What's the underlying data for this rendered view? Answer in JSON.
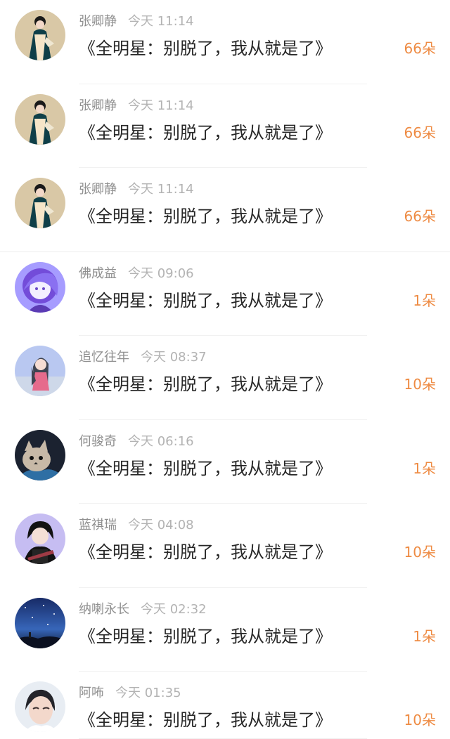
{
  "rows": [
    {
      "name": "张卿静",
      "time": "今天 11:14",
      "message": "《全明星：别脱了，我从就是了》",
      "count": "66朵",
      "avatar_icon": "hanfu-avatar-icon",
      "avatar_palette": [
        "#d9c8a6",
        "#0f3f48",
        "#f5e5c8"
      ]
    },
    {
      "name": "张卿静",
      "time": "今天 11:14",
      "message": "《全明星：别脱了，我从就是了》",
      "count": "66朵",
      "avatar_icon": "hanfu-avatar-icon",
      "avatar_palette": [
        "#d9c8a6",
        "#0f3f48",
        "#f5e5c8"
      ]
    },
    {
      "name": "张卿静",
      "time": "今天 11:14",
      "message": "《全明星：别脱了，我从就是了》",
      "count": "66朵",
      "avatar_icon": "hanfu-avatar-icon",
      "avatar_palette": [
        "#d9c8a6",
        "#0f3f48",
        "#f5e5c8"
      ]
    },
    {
      "name": "佛成益",
      "time": "今天 09:06",
      "message": "《全明星：别脱了，我从就是了》",
      "count": "1朵",
      "avatar_icon": "anime-purple-avatar-icon",
      "avatar_palette": [
        "#a69cff",
        "#734cd9",
        "#f4f0ff"
      ]
    },
    {
      "name": "追忆往年",
      "time": "今天 08:37",
      "message": "《全明星：别脱了，我从就是了》",
      "count": "10朵",
      "avatar_icon": "anime-girl-avatar-icon",
      "avatar_palette": [
        "#b9c8f1",
        "#3f4451",
        "#e66b8c"
      ]
    },
    {
      "name": "何骏奇",
      "time": "今天 06:16",
      "message": "《全明星：别脱了，我从就是了》",
      "count": "1朵",
      "avatar_icon": "cat-avatar-icon",
      "avatar_palette": [
        "#1b2230",
        "#c7b9a7",
        "#2e6fa4"
      ]
    },
    {
      "name": "蓝祺瑞",
      "time": "今天 04:08",
      "message": "《全明星：别脱了，我从就是了》",
      "count": "10朵",
      "avatar_icon": "ninja-avatar-icon",
      "avatar_palette": [
        "#c6bdf2",
        "#121212",
        "#9e3b45"
      ]
    },
    {
      "name": "纳喇永长",
      "time": "今天 02:32",
      "message": "《全明星：别脱了，我从就是了》",
      "count": "1朵",
      "avatar_icon": "night-sky-avatar-icon",
      "avatar_palette": [
        "#172a66",
        "#3766b9",
        "#0d1732"
      ]
    },
    {
      "name": "阿咘",
      "time": "今天 01:35",
      "message": "《全明星：别脱了，我从就是了》",
      "count": "10朵",
      "avatar_icon": "portrait-avatar-icon",
      "avatar_palette": [
        "#e8edf3",
        "#24242a",
        "#f3d8cb"
      ]
    }
  ]
}
